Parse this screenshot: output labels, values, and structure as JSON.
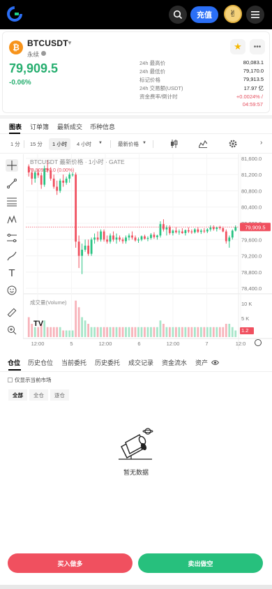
{
  "header": {
    "deposit_label": "充值"
  },
  "ticker": {
    "symbol": "BTCUSDT",
    "type": "永续",
    "price": "79,909.5",
    "change": "-0.06%",
    "stats": [
      {
        "label": "24h 最高价",
        "value": "80,083.1"
      },
      {
        "label": "24h 最低价",
        "value": "79,170.0"
      },
      {
        "label": "标记价格",
        "value": "79,913.5"
      },
      {
        "label": "24h 交易额(USDT)",
        "value": "17.97 亿"
      }
    ],
    "funding_label": "资金费率/倒计时",
    "funding_rate": "+0.0024% /",
    "funding_countdown": "04:59:57"
  },
  "tabs": [
    "图表",
    "订单簿",
    "最新成交",
    "币种信息"
  ],
  "toolbar": {
    "intervals": [
      "1 分",
      "15 分",
      "1 小时",
      "4 小时"
    ],
    "selected": "1 小时",
    "price_type": "最新价格"
  },
  "chart": {
    "title": "BTCUSDT 最新价格 · 1小时 · GATE",
    "ohlc": "79,909.5  0.0 (0.00%)",
    "volume_label": "成交量(Volume)",
    "last_price_tag": "79,909.5",
    "y_ticks": [
      "81,600.0",
      "81,200.0",
      "80,800.0",
      "80,400.0",
      "80,000.0",
      "79,600.0",
      "79,200.0",
      "78,800.0",
      "78,400.0"
    ],
    "vol_ticks": [
      "10 K",
      "5 K",
      "1.2"
    ],
    "x_ticks": [
      "12:00",
      "5",
      "12:00",
      "6",
      "12:00",
      "7",
      "12:0"
    ]
  },
  "chart_data": {
    "type": "candlestick",
    "title": "BTCUSDT 最新价格 · 1小时 · GATE",
    "x_ticks": [
      "12:00",
      "5",
      "12:00",
      "6",
      "12:00",
      "7",
      "12:0"
    ],
    "ylim": [
      78300,
      81700
    ],
    "last_price": 79909.5,
    "ohlc": [
      [
        81400,
        81450,
        81150,
        81250
      ],
      [
        81250,
        81350,
        80950,
        81100
      ],
      [
        81100,
        81300,
        81000,
        81250
      ],
      [
        81250,
        81330,
        81120,
        81180
      ],
      [
        81180,
        81250,
        80850,
        80950
      ],
      [
        80950,
        81420,
        80900,
        81350
      ],
      [
        81350,
        81550,
        81250,
        81300
      ],
      [
        81300,
        81380,
        81050,
        81100
      ],
      [
        81100,
        81200,
        80850,
        80900
      ],
      [
        80900,
        81050,
        80700,
        80800
      ],
      [
        80800,
        81100,
        80750,
        81050
      ],
      [
        81050,
        81200,
        80900,
        81000
      ],
      [
        81000,
        81150,
        80950,
        81100
      ],
      [
        81100,
        81250,
        81000,
        81200
      ],
      [
        81200,
        81250,
        81150,
        81200
      ],
      [
        81200,
        81250,
        79400,
        79550
      ],
      [
        79550,
        79700,
        78900,
        79200
      ],
      [
        79200,
        79500,
        78750,
        79350
      ],
      [
        79350,
        79600,
        79300,
        79450
      ],
      [
        79450,
        79600,
        79200,
        79250
      ],
      [
        79250,
        79650,
        79200,
        79600
      ],
      [
        79600,
        79750,
        79500,
        79650
      ],
      [
        79650,
        79800,
        79550,
        79600
      ],
      [
        79600,
        79850,
        79550,
        79800
      ],
      [
        79800,
        79850,
        79550,
        79600
      ],
      [
        79600,
        79700,
        79500,
        79550
      ],
      [
        79550,
        79750,
        79500,
        79700
      ],
      [
        79700,
        79800,
        79550,
        79600
      ],
      [
        79600,
        79750,
        79500,
        79650
      ],
      [
        79650,
        79700,
        79550,
        79600
      ],
      [
        79600,
        79650,
        79500,
        79560
      ],
      [
        79560,
        79700,
        79500,
        79650
      ],
      [
        79650,
        79750,
        79580,
        79700
      ],
      [
        79700,
        79800,
        79600,
        79650
      ],
      [
        79650,
        79700,
        79550,
        79580
      ],
      [
        79580,
        79650,
        79520,
        79600
      ],
      [
        79600,
        79700,
        79560,
        79680
      ],
      [
        79680,
        79720,
        79600,
        79620
      ],
      [
        79620,
        79680,
        79560,
        79640
      ],
      [
        79640,
        79760,
        79600,
        79720
      ],
      [
        79720,
        79780,
        79620,
        79660
      ],
      [
        79660,
        79720,
        79600,
        79700
      ],
      [
        79700,
        80050,
        79650,
        79980
      ],
      [
        79980,
        80100,
        79800,
        79850
      ],
      [
        79850,
        79950,
        79700,
        79900
      ],
      [
        79900,
        79950,
        79720,
        79760
      ],
      [
        79760,
        79850,
        79700,
        79820
      ],
      [
        79820,
        79900,
        79750,
        79780
      ],
      [
        79780,
        79850,
        79720,
        79800
      ],
      [
        79800,
        79880,
        79740,
        79760
      ],
      [
        79760,
        79850,
        79700,
        79830
      ],
      [
        79830,
        79900,
        79760,
        79800
      ],
      [
        79800,
        79850,
        79740,
        79780
      ],
      [
        79780,
        79880,
        79750,
        79850
      ],
      [
        79850,
        79900,
        79760,
        79790
      ],
      [
        79790,
        79860,
        79740,
        79820
      ],
      [
        79820,
        79880,
        79760,
        79800
      ],
      [
        79800,
        79880,
        79760,
        79850
      ],
      [
        79850,
        79950,
        79800,
        79900
      ],
      [
        79900,
        79950,
        79820,
        79860
      ],
      [
        79860,
        79920,
        79800,
        79900
      ],
      [
        79900,
        79940,
        79840,
        79880
      ],
      [
        79880,
        79920,
        79780,
        79800
      ],
      [
        79800,
        79850,
        79500,
        79560
      ],
      [
        79560,
        79700,
        79400,
        79650
      ],
      [
        79650,
        79850,
        79600,
        79820
      ],
      [
        79820,
        79950,
        79800,
        79910
      ]
    ],
    "volume": [
      6,
      4,
      3,
      3,
      4,
      5,
      3,
      3,
      3,
      3,
      3,
      2,
      2,
      2,
      2,
      11,
      9,
      6,
      5,
      4,
      3,
      3,
      3,
      3,
      3,
      3,
      3,
      3,
      3,
      3,
      3,
      3,
      3,
      3,
      3,
      3,
      3,
      3,
      3,
      3,
      3,
      3,
      5,
      4,
      3,
      3,
      3,
      3,
      3,
      3,
      3,
      3,
      3,
      3,
      3,
      3,
      3,
      3,
      3,
      3,
      3,
      3,
      3,
      4,
      4,
      3,
      2
    ]
  },
  "bottom_tabs": [
    "仓位",
    "历史仓位",
    "当前委托",
    "历史委托",
    "成交记录",
    "资金流水",
    "资产"
  ],
  "only_current_label": "仅显示当前市场",
  "filters": [
    "全部",
    "全仓",
    "逐仓"
  ],
  "empty_text": "暂无数据",
  "buy_label": "买入做多",
  "sell_label": "卖出做空"
}
